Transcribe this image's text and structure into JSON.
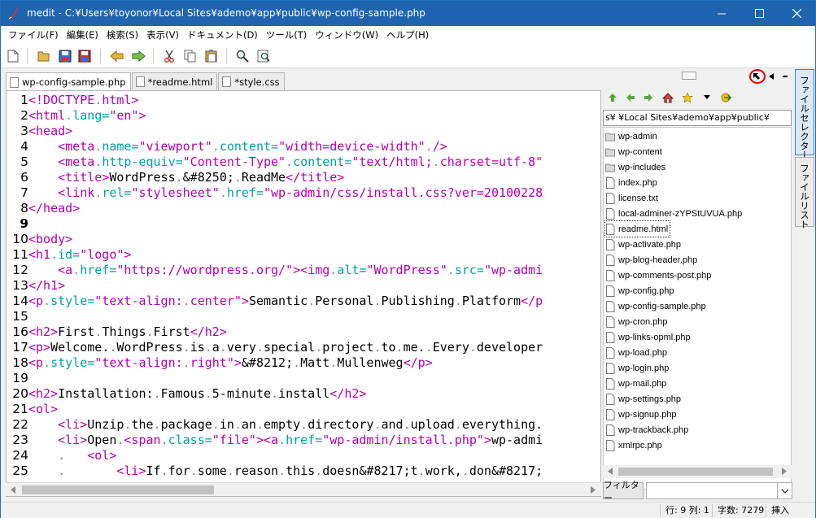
{
  "window": {
    "title": "medit - C:¥Users¥toyonor¥Local Sites¥ademo¥app¥public¥wp-config-sample.php"
  },
  "menu": [
    "ファイル(F)",
    "編集(E)",
    "検索(S)",
    "表示(V)",
    "ドキュメント(D)",
    "ツール(T)",
    "ウィンドウ(W)",
    "ヘルプ(H)"
  ],
  "toolbar": {
    "icons": [
      "new-file-icon",
      "open-folder-icon",
      "save-icon",
      "save-as-icon",
      "undo-icon",
      "redo-icon",
      "cut-icon",
      "copy-icon",
      "paste-icon",
      "find-icon",
      "replace-icon"
    ]
  },
  "tabs": [
    {
      "label": "wp-config-sample.php",
      "active": true
    },
    {
      "label": "*readme.html",
      "active": false
    },
    {
      "label": "*style.css",
      "active": false
    }
  ],
  "editor": {
    "current_line": 9,
    "lines": [
      {
        "n": "1",
        "segs": [
          [
            "t",
            "<!DOCTYPE"
          ],
          [
            "ws",
            "."
          ],
          [
            "t",
            "html>"
          ]
        ]
      },
      {
        "n": "2",
        "segs": [
          [
            "t",
            "<html"
          ],
          [
            "ws",
            "."
          ],
          [
            "a",
            "lang="
          ],
          [
            "v",
            "\"en\""
          ],
          [
            "t",
            ">"
          ]
        ]
      },
      {
        "n": "3",
        "segs": [
          [
            "t",
            "<head>"
          ]
        ]
      },
      {
        "n": "4",
        "segs": [
          [
            "ws",
            "    "
          ],
          [
            "t",
            "<meta"
          ],
          [
            "ws",
            "."
          ],
          [
            "a",
            "name="
          ],
          [
            "v",
            "\"viewport\""
          ],
          [
            "ws",
            "."
          ],
          [
            "a",
            "content="
          ],
          [
            "v",
            "\"width=device-width\""
          ],
          [
            "ws",
            "."
          ],
          [
            "t",
            "/>"
          ]
        ]
      },
      {
        "n": "5",
        "segs": [
          [
            "ws",
            "    "
          ],
          [
            "t",
            "<meta"
          ],
          [
            "ws",
            "."
          ],
          [
            "a",
            "http-equiv="
          ],
          [
            "v",
            "\"Content-Type\""
          ],
          [
            "ws",
            "."
          ],
          [
            "a",
            "content="
          ],
          [
            "v",
            "\"text/html;"
          ],
          [
            "ws",
            "."
          ],
          [
            "v",
            "charset=utf-8\""
          ]
        ]
      },
      {
        "n": "6",
        "segs": [
          [
            "ws",
            "    "
          ],
          [
            "t",
            "<title>"
          ],
          [
            "x",
            "WordPress"
          ],
          [
            "ws",
            "."
          ],
          [
            "x",
            "&#8250;"
          ],
          [
            "ws",
            "."
          ],
          [
            "x",
            "ReadMe"
          ],
          [
            "t",
            "</title>"
          ]
        ]
      },
      {
        "n": "7",
        "segs": [
          [
            "ws",
            "    "
          ],
          [
            "t",
            "<link"
          ],
          [
            "ws",
            "."
          ],
          [
            "a",
            "rel="
          ],
          [
            "v",
            "\"stylesheet\""
          ],
          [
            "ws",
            "."
          ],
          [
            "a",
            "href="
          ],
          [
            "v",
            "\"wp-admin/css/install.css?ver=20100228"
          ]
        ]
      },
      {
        "n": "8",
        "segs": [
          [
            "t",
            "</head>"
          ]
        ]
      },
      {
        "n": "9",
        "segs": []
      },
      {
        "n": "10",
        "segs": [
          [
            "t",
            "<body>"
          ]
        ]
      },
      {
        "n": "11",
        "segs": [
          [
            "t",
            "<h1"
          ],
          [
            "ws",
            "."
          ],
          [
            "a",
            "id="
          ],
          [
            "v",
            "\"logo\""
          ],
          [
            "t",
            ">"
          ]
        ]
      },
      {
        "n": "12",
        "segs": [
          [
            "ws",
            "    "
          ],
          [
            "t",
            "<a"
          ],
          [
            "ws",
            "."
          ],
          [
            "a",
            "href="
          ],
          [
            "v",
            "\"https://wordpress.org/\""
          ],
          [
            "t",
            "><img"
          ],
          [
            "ws",
            "."
          ],
          [
            "a",
            "alt="
          ],
          [
            "v",
            "\"WordPress\""
          ],
          [
            "ws",
            "."
          ],
          [
            "a",
            "src="
          ],
          [
            "v",
            "\"wp-admi"
          ]
        ]
      },
      {
        "n": "13",
        "segs": [
          [
            "t",
            "</h1>"
          ]
        ]
      },
      {
        "n": "14",
        "segs": [
          [
            "t",
            "<p"
          ],
          [
            "ws",
            "."
          ],
          [
            "a",
            "style="
          ],
          [
            "v",
            "\"text-align:"
          ],
          [
            "ws",
            "."
          ],
          [
            "v",
            "center\""
          ],
          [
            "t",
            ">"
          ],
          [
            "x",
            "Semantic"
          ],
          [
            "ws",
            "."
          ],
          [
            "x",
            "Personal"
          ],
          [
            "ws",
            "."
          ],
          [
            "x",
            "Publishing"
          ],
          [
            "ws",
            "."
          ],
          [
            "x",
            "Platform"
          ],
          [
            "t",
            "</p"
          ]
        ]
      },
      {
        "n": "15",
        "segs": []
      },
      {
        "n": "16",
        "segs": [
          [
            "t",
            "<h2>"
          ],
          [
            "x",
            "First"
          ],
          [
            "ws",
            "."
          ],
          [
            "x",
            "Things"
          ],
          [
            "ws",
            "."
          ],
          [
            "x",
            "First"
          ],
          [
            "t",
            "</h2>"
          ]
        ]
      },
      {
        "n": "17",
        "segs": [
          [
            "t",
            "<p>"
          ],
          [
            "x",
            "Welcome."
          ],
          [
            "ws",
            "."
          ],
          [
            "x",
            "WordPress"
          ],
          [
            "ws",
            "."
          ],
          [
            "x",
            "is"
          ],
          [
            "ws",
            "."
          ],
          [
            "x",
            "a"
          ],
          [
            "ws",
            "."
          ],
          [
            "x",
            "very"
          ],
          [
            "ws",
            "."
          ],
          [
            "x",
            "special"
          ],
          [
            "ws",
            "."
          ],
          [
            "x",
            "project"
          ],
          [
            "ws",
            "."
          ],
          [
            "x",
            "to"
          ],
          [
            "ws",
            "."
          ],
          [
            "x",
            "me."
          ],
          [
            "ws",
            "."
          ],
          [
            "x",
            "Every"
          ],
          [
            "ws",
            "."
          ],
          [
            "x",
            "developer"
          ]
        ]
      },
      {
        "n": "18",
        "segs": [
          [
            "t",
            "<p"
          ],
          [
            "ws",
            "."
          ],
          [
            "a",
            "style="
          ],
          [
            "v",
            "\"text-align:"
          ],
          [
            "ws",
            "."
          ],
          [
            "v",
            "right\""
          ],
          [
            "t",
            ">"
          ],
          [
            "x",
            "&#8212;"
          ],
          [
            "ws",
            "."
          ],
          [
            "x",
            "Matt"
          ],
          [
            "ws",
            "."
          ],
          [
            "x",
            "Mullenweg"
          ],
          [
            "t",
            "</p>"
          ]
        ]
      },
      {
        "n": "19",
        "segs": []
      },
      {
        "n": "20",
        "segs": [
          [
            "t",
            "<h2>"
          ],
          [
            "x",
            "Installation:"
          ],
          [
            "ws",
            "."
          ],
          [
            "x",
            "Famous"
          ],
          [
            "ws",
            "."
          ],
          [
            "x",
            "5-minute"
          ],
          [
            "ws",
            "."
          ],
          [
            "x",
            "install"
          ],
          [
            "t",
            "</h2>"
          ]
        ]
      },
      {
        "n": "21",
        "segs": [
          [
            "t",
            "<ol>"
          ]
        ]
      },
      {
        "n": "22",
        "segs": [
          [
            "ws",
            "    "
          ],
          [
            "t",
            "<li>"
          ],
          [
            "x",
            "Unzip"
          ],
          [
            "ws",
            "."
          ],
          [
            "x",
            "the"
          ],
          [
            "ws",
            "."
          ],
          [
            "x",
            "package"
          ],
          [
            "ws",
            "."
          ],
          [
            "x",
            "in"
          ],
          [
            "ws",
            "."
          ],
          [
            "x",
            "an"
          ],
          [
            "ws",
            "."
          ],
          [
            "x",
            "empty"
          ],
          [
            "ws",
            "."
          ],
          [
            "x",
            "directory"
          ],
          [
            "ws",
            "."
          ],
          [
            "x",
            "and"
          ],
          [
            "ws",
            "."
          ],
          [
            "x",
            "upload"
          ],
          [
            "ws",
            "."
          ],
          [
            "x",
            "everything."
          ]
        ]
      },
      {
        "n": "23",
        "segs": [
          [
            "ws",
            "    "
          ],
          [
            "t",
            "<li>"
          ],
          [
            "x",
            "Open"
          ],
          [
            "ws",
            "."
          ],
          [
            "t",
            "<span"
          ],
          [
            "ws",
            "."
          ],
          [
            "a",
            "class="
          ],
          [
            "v",
            "\"file\""
          ],
          [
            "t",
            "><a"
          ],
          [
            "ws",
            "."
          ],
          [
            "a",
            "href="
          ],
          [
            "v",
            "\"wp-admin/install.php\""
          ],
          [
            "t",
            ">"
          ],
          [
            "x",
            "wp-admi"
          ]
        ]
      },
      {
        "n": "24",
        "segs": [
          [
            "ws",
            "    .   "
          ],
          [
            "t",
            "<ol>"
          ]
        ]
      },
      {
        "n": "25",
        "segs": [
          [
            "ws",
            "    .       "
          ],
          [
            "t",
            "<li>"
          ],
          [
            "x",
            "If"
          ],
          [
            "ws",
            "."
          ],
          [
            "x",
            "for"
          ],
          [
            "ws",
            "."
          ],
          [
            "x",
            "some"
          ],
          [
            "ws",
            "."
          ],
          [
            "x",
            "reason"
          ],
          [
            "ws",
            "."
          ],
          [
            "x",
            "this"
          ],
          [
            "ws",
            "."
          ],
          [
            "x",
            "doesn&#8217;t"
          ],
          [
            "ws",
            "."
          ],
          [
            "x",
            "work,"
          ],
          [
            "ws",
            "."
          ],
          [
            "x",
            "don&#8217;"
          ]
        ]
      }
    ]
  },
  "filepane": {
    "path": "s¥            ¥Local Sites¥ademo¥app¥public¥",
    "items": [
      {
        "name": "wp-admin",
        "type": "folder"
      },
      {
        "name": "wp-content",
        "type": "folder"
      },
      {
        "name": "wp-includes",
        "type": "folder"
      },
      {
        "name": "index.php",
        "type": "file"
      },
      {
        "name": "license.txt",
        "type": "file"
      },
      {
        "name": "local-adminer-zYPStUVUA.php",
        "type": "file"
      },
      {
        "name": "readme.html",
        "type": "file",
        "selected": true
      },
      {
        "name": "wp-activate.php",
        "type": "file"
      },
      {
        "name": "wp-blog-header.php",
        "type": "file"
      },
      {
        "name": "wp-comments-post.php",
        "type": "file"
      },
      {
        "name": "wp-config.php",
        "type": "file"
      },
      {
        "name": "wp-config-sample.php",
        "type": "file"
      },
      {
        "name": "wp-cron.php",
        "type": "file"
      },
      {
        "name": "wp-links-opml.php",
        "type": "file"
      },
      {
        "name": "wp-load.php",
        "type": "file"
      },
      {
        "name": "wp-login.php",
        "type": "file"
      },
      {
        "name": "wp-mail.php",
        "type": "file"
      },
      {
        "name": "wp-settings.php",
        "type": "file"
      },
      {
        "name": "wp-signup.php",
        "type": "file"
      },
      {
        "name": "wp-trackback.php",
        "type": "file"
      },
      {
        "name": "xmlrpc.php",
        "type": "file"
      }
    ],
    "filter_label": "フィルター",
    "filter_value": ""
  },
  "side_tabs": {
    "file_selector": "ファイルセレクター",
    "file_list": "ファイルリスト"
  },
  "status": {
    "position": "行: 9 列: 1",
    "chars": "字数: 7279",
    "mode": "挿入"
  }
}
